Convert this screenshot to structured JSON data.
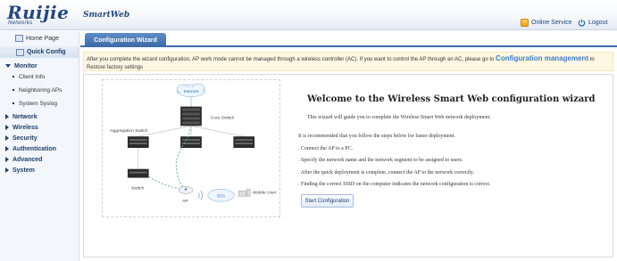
{
  "header": {
    "logo": "Ruijie",
    "logo_sub": "Networks",
    "product": "SmartWeb",
    "online_service": "Online Service",
    "logout": "Logout"
  },
  "sidebar": {
    "home": "Home Page",
    "quick_config": "Quick Config",
    "monitor": "Monitor",
    "monitor_items": [
      "Client Info",
      "Neighboring APs",
      "System Syslog"
    ],
    "menus": [
      "Network",
      "Wireless",
      "Security",
      "Authentication",
      "Advanced",
      "System"
    ]
  },
  "tab": {
    "label": "Configuration Wizard"
  },
  "notice": {
    "text_before": "After you complete the wizard configuration, AP work mode cannot be managed through a wireless controller (AC). If you want to control the AP through an AC, please go to",
    "link": "Configuration management",
    "text_after": "to Restore factory settings"
  },
  "diagram": {
    "internet": "Internet",
    "core_switch": "Core Switch",
    "aggregation_switch": "Aggregation Switch",
    "switch": "Switch",
    "ap": "AP",
    "sta": "STA",
    "mobile_user": "Mobile User"
  },
  "wizard": {
    "title": "Welcome to the Wireless Smart Web configuration wizard",
    "subtitle": "This wizard will guide you to complete the Wireless Smart Web network deployment.",
    "intro": "It is recommended that you follow the steps below for faster deployment.",
    "steps": [
      ". Connect the AP to a PC.",
      ". Specify the network name and the network segment to be assigned to users.",
      ". After the quick deployment is complete, connect the AP to the network correctly.",
      ". Finding the correct SSID on the computer indicates the network configuration is correct."
    ],
    "start_button": "Start Configuration"
  },
  "colors": {
    "brand": "#24467c",
    "tab": "#3c6aa6",
    "link": "#3d7cc9",
    "notice_bg": "#fdf7e3"
  }
}
